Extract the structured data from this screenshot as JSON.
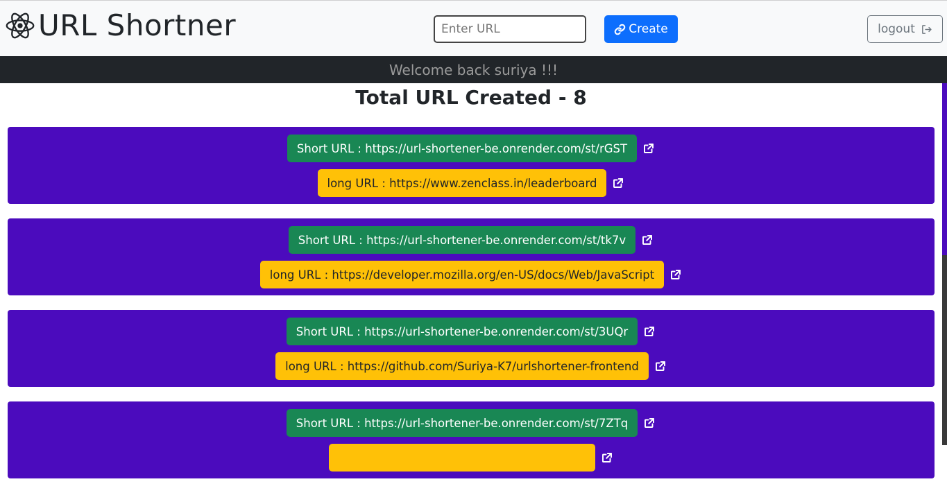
{
  "navbar": {
    "brand": "URL Shortner",
    "url_input": {
      "placeholder": "Enter URL",
      "value": ""
    },
    "create_label": "Create",
    "logout_label": "logout"
  },
  "welcome": "Welcome back suriya !!!",
  "total_title": "Total URL Created - 8",
  "urls": [
    {
      "short": "Short URL : https://url-shortener-be.onrender.com/st/rGST",
      "long": "long URL : https://www.zenclass.in/leaderboard"
    },
    {
      "short": "Short URL : https://url-shortener-be.onrender.com/st/tk7v",
      "long": "long URL : https://developer.mozilla.org/en-US/docs/Web/JavaScript"
    },
    {
      "short": "Short URL : https://url-shortener-be.onrender.com/st/3UQr",
      "long": "long URL : https://github.com/Suriya-K7/urlshortener-frontend"
    },
    {
      "short": "Short URL : https://url-shortener-be.onrender.com/st/7ZTq",
      "long": ""
    }
  ],
  "colors": {
    "card_bg": "#4b0bbd",
    "short_pill": "#198754",
    "long_pill": "#ffc107",
    "primary": "#0d6efd",
    "welcome_bar": "#212529"
  },
  "icons": {
    "brand": "react-atom-icon",
    "create": "link-icon",
    "logout": "sign-out-icon",
    "open": "external-link-icon"
  }
}
